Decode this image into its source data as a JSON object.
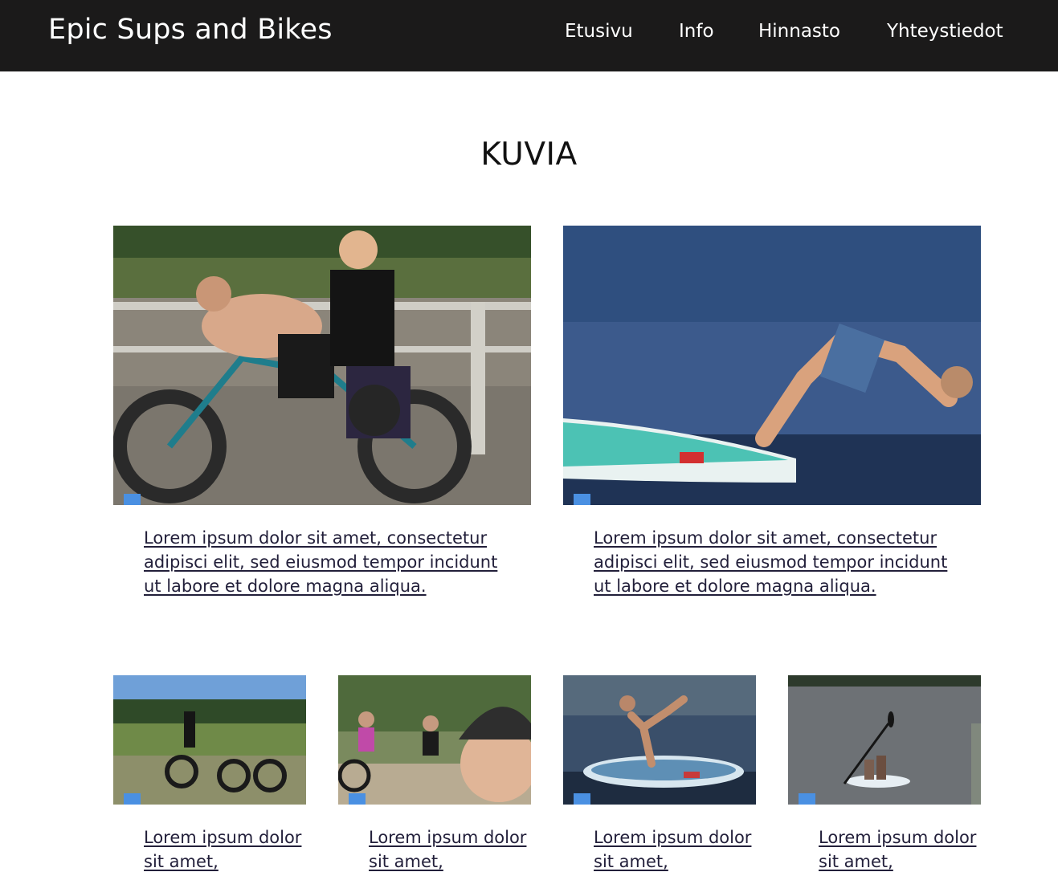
{
  "header": {
    "brand": "Epic Sups and Bikes",
    "nav": [
      "Etusivu",
      "Info",
      "Hinnasto",
      "Yhteystiedot"
    ]
  },
  "section": {
    "title": "KUVIA"
  },
  "gallery": {
    "large": [
      {
        "caption": "Lorem ipsum dolor sit amet, consectetur adipisci elit, sed eiusmod tempor incidunt ut labore et dolore magna aliqua."
      },
      {
        "caption": "Lorem ipsum dolor sit amet, consectetur adipisci elit, sed eiusmod tempor incidunt ut labore et dolore magna aliqua."
      }
    ],
    "small": [
      {
        "caption": "Lorem ipsum dolor sit amet,"
      },
      {
        "caption": "Lorem ipsum dolor sit amet,"
      },
      {
        "caption": "Lorem ipsum dolor sit amet,"
      },
      {
        "caption": "Lorem ipsum dolor sit amet,"
      }
    ]
  },
  "colors": {
    "header_bg": "#1b1a1a",
    "marker": "#4a90e2",
    "caption": "#221f3a"
  }
}
